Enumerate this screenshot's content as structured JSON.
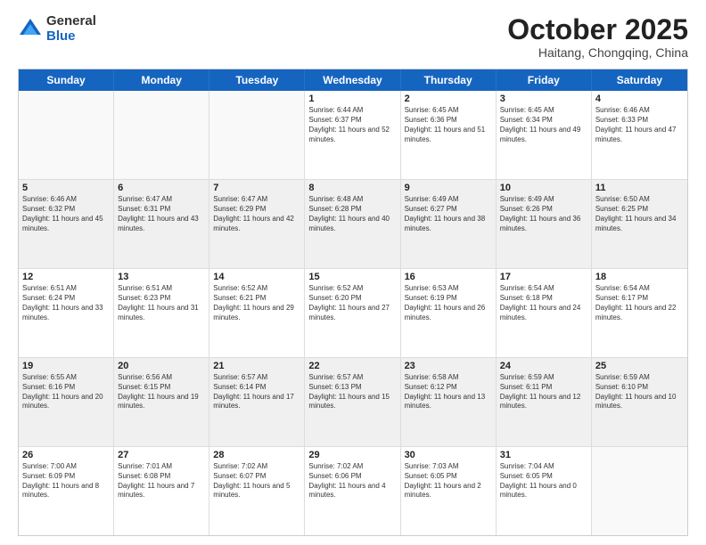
{
  "logo": {
    "general": "General",
    "blue": "Blue"
  },
  "header": {
    "month": "October 2025",
    "location": "Haitang, Chongqing, China"
  },
  "weekdays": [
    "Sunday",
    "Monday",
    "Tuesday",
    "Wednesday",
    "Thursday",
    "Friday",
    "Saturday"
  ],
  "rows": [
    [
      {
        "day": "",
        "empty": true
      },
      {
        "day": "",
        "empty": true
      },
      {
        "day": "",
        "empty": true
      },
      {
        "day": "1",
        "sunrise": "Sunrise: 6:44 AM",
        "sunset": "Sunset: 6:37 PM",
        "daylight": "Daylight: 11 hours and 52 minutes."
      },
      {
        "day": "2",
        "sunrise": "Sunrise: 6:45 AM",
        "sunset": "Sunset: 6:36 PM",
        "daylight": "Daylight: 11 hours and 51 minutes."
      },
      {
        "day": "3",
        "sunrise": "Sunrise: 6:45 AM",
        "sunset": "Sunset: 6:34 PM",
        "daylight": "Daylight: 11 hours and 49 minutes."
      },
      {
        "day": "4",
        "sunrise": "Sunrise: 6:46 AM",
        "sunset": "Sunset: 6:33 PM",
        "daylight": "Daylight: 11 hours and 47 minutes."
      }
    ],
    [
      {
        "day": "5",
        "sunrise": "Sunrise: 6:46 AM",
        "sunset": "Sunset: 6:32 PM",
        "daylight": "Daylight: 11 hours and 45 minutes."
      },
      {
        "day": "6",
        "sunrise": "Sunrise: 6:47 AM",
        "sunset": "Sunset: 6:31 PM",
        "daylight": "Daylight: 11 hours and 43 minutes."
      },
      {
        "day": "7",
        "sunrise": "Sunrise: 6:47 AM",
        "sunset": "Sunset: 6:29 PM",
        "daylight": "Daylight: 11 hours and 42 minutes."
      },
      {
        "day": "8",
        "sunrise": "Sunrise: 6:48 AM",
        "sunset": "Sunset: 6:28 PM",
        "daylight": "Daylight: 11 hours and 40 minutes."
      },
      {
        "day": "9",
        "sunrise": "Sunrise: 6:49 AM",
        "sunset": "Sunset: 6:27 PM",
        "daylight": "Daylight: 11 hours and 38 minutes."
      },
      {
        "day": "10",
        "sunrise": "Sunrise: 6:49 AM",
        "sunset": "Sunset: 6:26 PM",
        "daylight": "Daylight: 11 hours and 36 minutes."
      },
      {
        "day": "11",
        "sunrise": "Sunrise: 6:50 AM",
        "sunset": "Sunset: 6:25 PM",
        "daylight": "Daylight: 11 hours and 34 minutes."
      }
    ],
    [
      {
        "day": "12",
        "sunrise": "Sunrise: 6:51 AM",
        "sunset": "Sunset: 6:24 PM",
        "daylight": "Daylight: 11 hours and 33 minutes."
      },
      {
        "day": "13",
        "sunrise": "Sunrise: 6:51 AM",
        "sunset": "Sunset: 6:23 PM",
        "daylight": "Daylight: 11 hours and 31 minutes."
      },
      {
        "day": "14",
        "sunrise": "Sunrise: 6:52 AM",
        "sunset": "Sunset: 6:21 PM",
        "daylight": "Daylight: 11 hours and 29 minutes."
      },
      {
        "day": "15",
        "sunrise": "Sunrise: 6:52 AM",
        "sunset": "Sunset: 6:20 PM",
        "daylight": "Daylight: 11 hours and 27 minutes."
      },
      {
        "day": "16",
        "sunrise": "Sunrise: 6:53 AM",
        "sunset": "Sunset: 6:19 PM",
        "daylight": "Daylight: 11 hours and 26 minutes."
      },
      {
        "day": "17",
        "sunrise": "Sunrise: 6:54 AM",
        "sunset": "Sunset: 6:18 PM",
        "daylight": "Daylight: 11 hours and 24 minutes."
      },
      {
        "day": "18",
        "sunrise": "Sunrise: 6:54 AM",
        "sunset": "Sunset: 6:17 PM",
        "daylight": "Daylight: 11 hours and 22 minutes."
      }
    ],
    [
      {
        "day": "19",
        "sunrise": "Sunrise: 6:55 AM",
        "sunset": "Sunset: 6:16 PM",
        "daylight": "Daylight: 11 hours and 20 minutes."
      },
      {
        "day": "20",
        "sunrise": "Sunrise: 6:56 AM",
        "sunset": "Sunset: 6:15 PM",
        "daylight": "Daylight: 11 hours and 19 minutes."
      },
      {
        "day": "21",
        "sunrise": "Sunrise: 6:57 AM",
        "sunset": "Sunset: 6:14 PM",
        "daylight": "Daylight: 11 hours and 17 minutes."
      },
      {
        "day": "22",
        "sunrise": "Sunrise: 6:57 AM",
        "sunset": "Sunset: 6:13 PM",
        "daylight": "Daylight: 11 hours and 15 minutes."
      },
      {
        "day": "23",
        "sunrise": "Sunrise: 6:58 AM",
        "sunset": "Sunset: 6:12 PM",
        "daylight": "Daylight: 11 hours and 13 minutes."
      },
      {
        "day": "24",
        "sunrise": "Sunrise: 6:59 AM",
        "sunset": "Sunset: 6:11 PM",
        "daylight": "Daylight: 11 hours and 12 minutes."
      },
      {
        "day": "25",
        "sunrise": "Sunrise: 6:59 AM",
        "sunset": "Sunset: 6:10 PM",
        "daylight": "Daylight: 11 hours and 10 minutes."
      }
    ],
    [
      {
        "day": "26",
        "sunrise": "Sunrise: 7:00 AM",
        "sunset": "Sunset: 6:09 PM",
        "daylight": "Daylight: 11 hours and 8 minutes."
      },
      {
        "day": "27",
        "sunrise": "Sunrise: 7:01 AM",
        "sunset": "Sunset: 6:08 PM",
        "daylight": "Daylight: 11 hours and 7 minutes."
      },
      {
        "day": "28",
        "sunrise": "Sunrise: 7:02 AM",
        "sunset": "Sunset: 6:07 PM",
        "daylight": "Daylight: 11 hours and 5 minutes."
      },
      {
        "day": "29",
        "sunrise": "Sunrise: 7:02 AM",
        "sunset": "Sunset: 6:06 PM",
        "daylight": "Daylight: 11 hours and 4 minutes."
      },
      {
        "day": "30",
        "sunrise": "Sunrise: 7:03 AM",
        "sunset": "Sunset: 6:05 PM",
        "daylight": "Daylight: 11 hours and 2 minutes."
      },
      {
        "day": "31",
        "sunrise": "Sunrise: 7:04 AM",
        "sunset": "Sunset: 6:05 PM",
        "daylight": "Daylight: 11 hours and 0 minutes."
      },
      {
        "day": "",
        "empty": true
      }
    ]
  ]
}
